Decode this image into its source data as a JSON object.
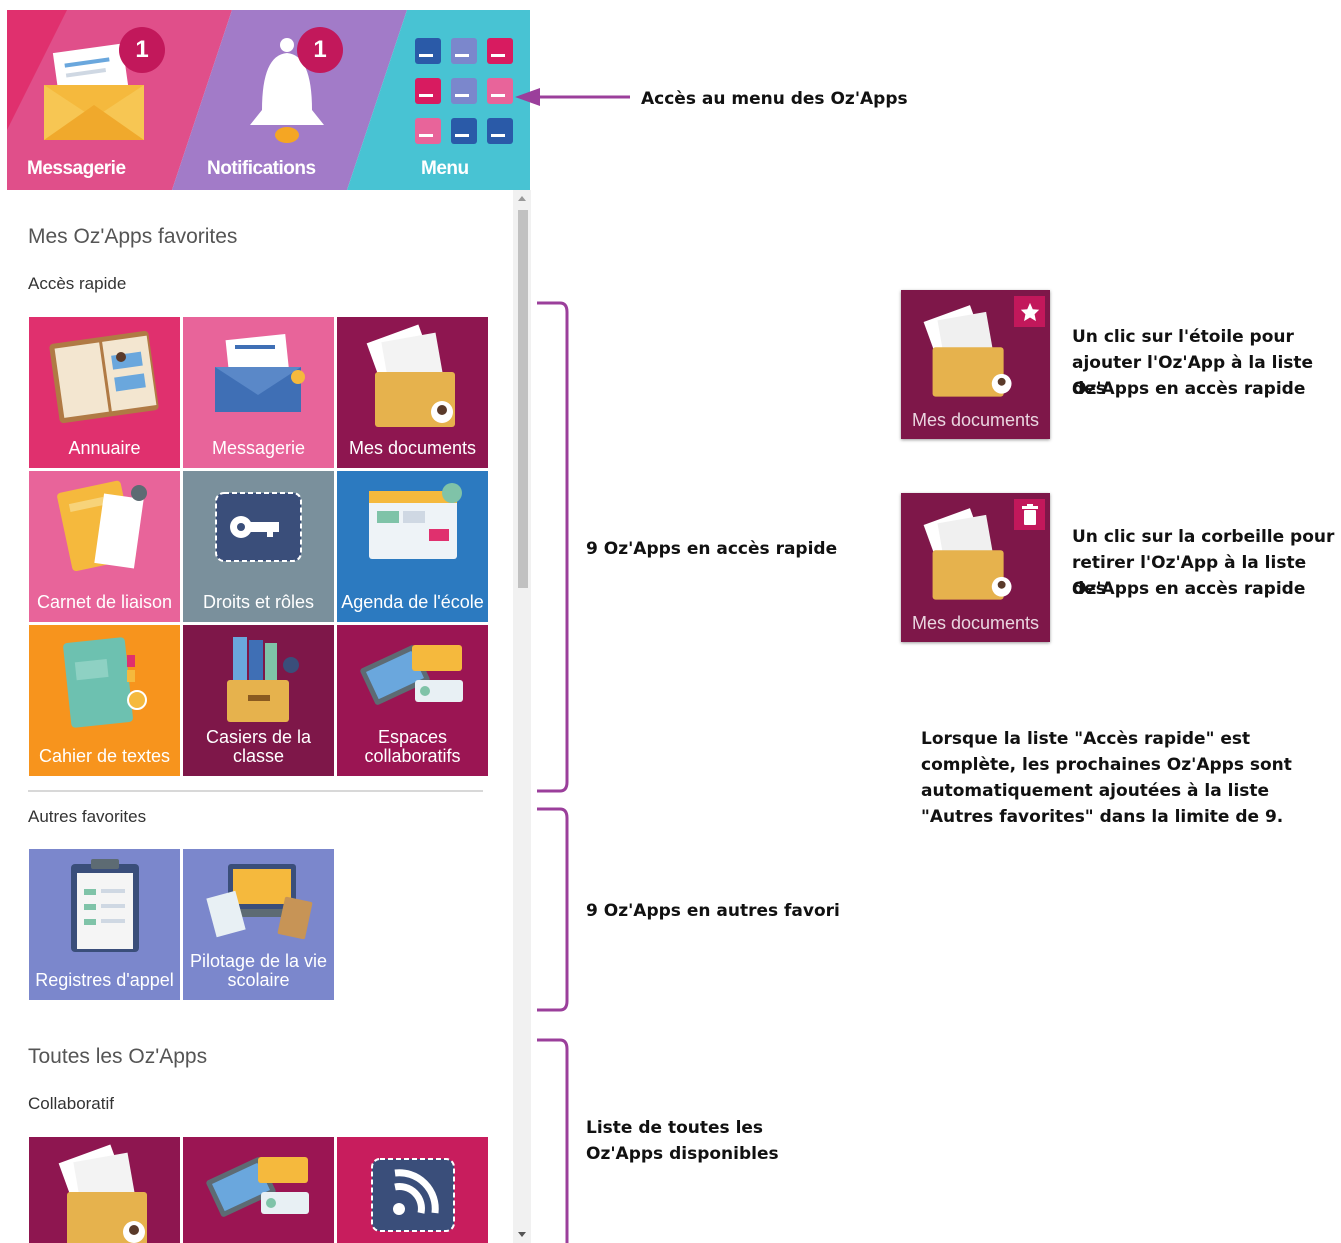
{
  "header": {
    "messagerie": {
      "label": "Messagerie",
      "badge": "1"
    },
    "notifications": {
      "label": "Notifications",
      "badge": "1"
    },
    "menu": {
      "label": "Menu"
    }
  },
  "panel": {
    "favorites_title": "Mes Oz'Apps favorites",
    "quick_access_title": "Accès rapide",
    "quick_tiles": [
      {
        "label": "Annuaire",
        "color": "#e0306e",
        "icon": "address-book-icon"
      },
      {
        "label": "Messagerie",
        "color": "#e8649a",
        "icon": "envelope-icon"
      },
      {
        "label": "Mes documents",
        "color": "#8e1650",
        "icon": "folder-documents-icon"
      },
      {
        "label": "Carnet de liaison",
        "color": "#e8649a",
        "icon": "notebook-icon"
      },
      {
        "label": "Droits et rôles",
        "color": "#7a909c",
        "icon": "key-icon"
      },
      {
        "label": "Agenda de l'école",
        "color": "#2c7ac0",
        "icon": "calendar-icon"
      },
      {
        "label": "Cahier de textes",
        "color": "#f7941d",
        "icon": "textbook-icon"
      },
      {
        "label": "Casiers de la classe",
        "color": "#7e1749",
        "icon": "lockers-icon"
      },
      {
        "label": "Espaces collaboratifs",
        "color": "#9b1553",
        "icon": "collaboration-icon"
      }
    ],
    "other_favorites_title": "Autres favorites",
    "other_tiles": [
      {
        "label": "Registres d'appel",
        "color": "#7b87cc",
        "icon": "clipboard-icon"
      },
      {
        "label": "Pilotage de la vie scolaire",
        "color": "#7b87cc",
        "icon": "laptop-icon"
      }
    ],
    "all_apps_title": "Toutes les Oz'Apps",
    "collaboratif_title": "Collaboratif",
    "collab_tiles": [
      {
        "label": "",
        "color": "#8e1650",
        "icon": "folder-documents-icon"
      },
      {
        "label": "",
        "color": "#9b1553",
        "icon": "collaboration-icon"
      },
      {
        "label": "",
        "color": "#c81d5d",
        "icon": "rss-icon"
      }
    ]
  },
  "annotations": {
    "menu_access": "Accès au menu des Oz'Apps",
    "quick_access": "9 Oz'Apps en accès rapide",
    "other_favorites": "9 Oz'Apps en autres favori",
    "all_apps_line1": "Liste de toutes les",
    "all_apps_line2": "Oz'Apps disponibles",
    "star_line1": "Un clic sur l'étoile pour",
    "star_line2": "ajouter l'Oz'App à la liste des",
    "star_line3": "Oz'Apps en accès rapide",
    "trash_line1": "Un clic sur la corbeille pour",
    "trash_line2": "retirer l'Oz'App à la liste des",
    "trash_line3": "Oz'Apps en accès rapide",
    "full_line1": "Lorsque la liste \"Accès rapide\" est",
    "full_line2": "complète, les prochaines Oz'Apps sont",
    "full_line3": "automatiquement ajoutées à la liste",
    "full_line4": "\"Autres favorites\" dans la limite de 9.",
    "demo_tile_label": "Mes documents",
    "demo_tile_label_2": "Mes documents"
  },
  "colors": {
    "accent": "#c2185b",
    "bracket": "#9b3f9b"
  }
}
